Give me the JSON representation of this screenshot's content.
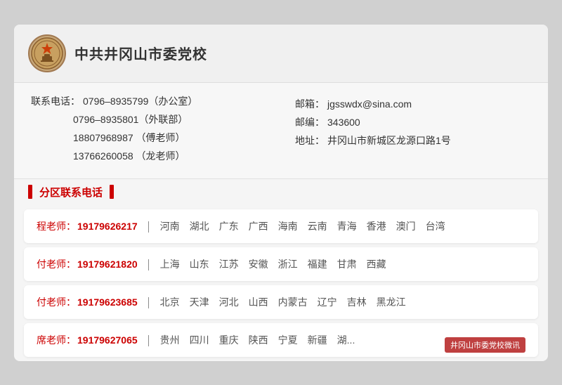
{
  "header": {
    "school_name": "中共井冈山市委党校"
  },
  "contact": {
    "phone_label": "联系电话：",
    "phone1": "0796–8935799（办公室）",
    "phone2": "0796–8935801（外联部）",
    "phone3": "18807968987 （傅老师）",
    "phone4": "13766260058 （龙老师）",
    "email_label": "邮箱：",
    "email": "jgsswdx@sina.com",
    "postcode_label": "邮编：",
    "postcode": "343600",
    "address_label": "地址：",
    "address": "井冈山市新城区龙源口路1号"
  },
  "section_title": "分区联系电话",
  "districts": [
    {
      "teacher": "程老师：",
      "phone": "19179626217",
      "divider": "｜",
      "regions": [
        "河南",
        "湖北",
        "广东",
        "广西",
        "海南",
        "云南",
        "青海",
        "香港",
        "澳门",
        "台湾"
      ]
    },
    {
      "teacher": "付老师：",
      "phone": "19179621820",
      "divider": "｜",
      "regions": [
        "上海",
        "山东",
        "江苏",
        "安徽",
        "浙江",
        "福建",
        "甘肃",
        "西藏"
      ]
    },
    {
      "teacher": "付老师：",
      "phone": "19179623685",
      "divider": "｜",
      "regions": [
        "北京",
        "天津",
        "河北",
        "山西",
        "内蒙古",
        "辽宁",
        "吉林",
        "黑龙江"
      ]
    },
    {
      "teacher": "席老师：",
      "phone": "19179627065",
      "divider": "｜",
      "regions": [
        "贵州",
        "四川",
        "重庆",
        "陕西",
        "宁夏",
        "新疆",
        "湖..."
      ],
      "has_watermark": true,
      "watermark": "井冈山市委党校微讯"
    }
  ]
}
